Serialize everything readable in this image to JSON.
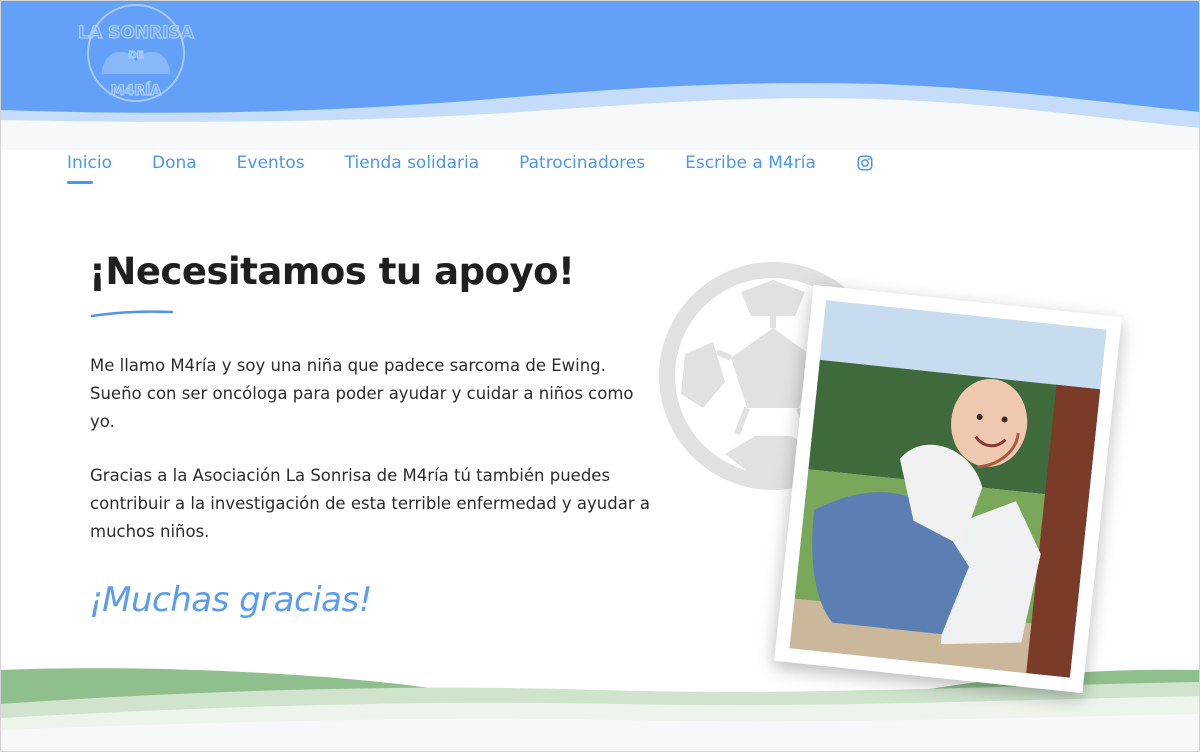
{
  "brand": {
    "logo_alt": "La Sonrisa de M4ría logo",
    "logo_text_top": "LA SONRISA",
    "logo_text_middle": "DE",
    "logo_text_bottom": "M4RÍA"
  },
  "nav": {
    "items": [
      {
        "label": "Inicio",
        "active": true
      },
      {
        "label": "Dona",
        "active": false
      },
      {
        "label": "Eventos",
        "active": false
      },
      {
        "label": "Tienda solidaria",
        "active": false
      },
      {
        "label": "Patrocinadores",
        "active": false
      },
      {
        "label": "Escribe a M4ría",
        "active": false
      }
    ],
    "social_icon": "instagram-icon"
  },
  "main": {
    "headline": "¡Necesitamos tu apoyo!",
    "paragraph1": "Me llamo M4ría y soy una niña que padece sarcoma de Ewing. Sueño con ser oncóloga para poder ayudar y cuidar a niños como yo.",
    "paragraph2": "Gracias a la Asociación La Sonrisa de M4ría tú también puedes contribuir a la investigación de esta terrible enfermedad y ayudar a muchos niños.",
    "thanks": "¡Muchas gracias!"
  },
  "colors": {
    "header_blue": "#62a1f7",
    "header_light": "#c6dcfb",
    "accent": "#4e97e8",
    "thanks": "#5a9cf0",
    "grass": "#8fbf8c",
    "ball_gray": "#e3e3e3"
  }
}
